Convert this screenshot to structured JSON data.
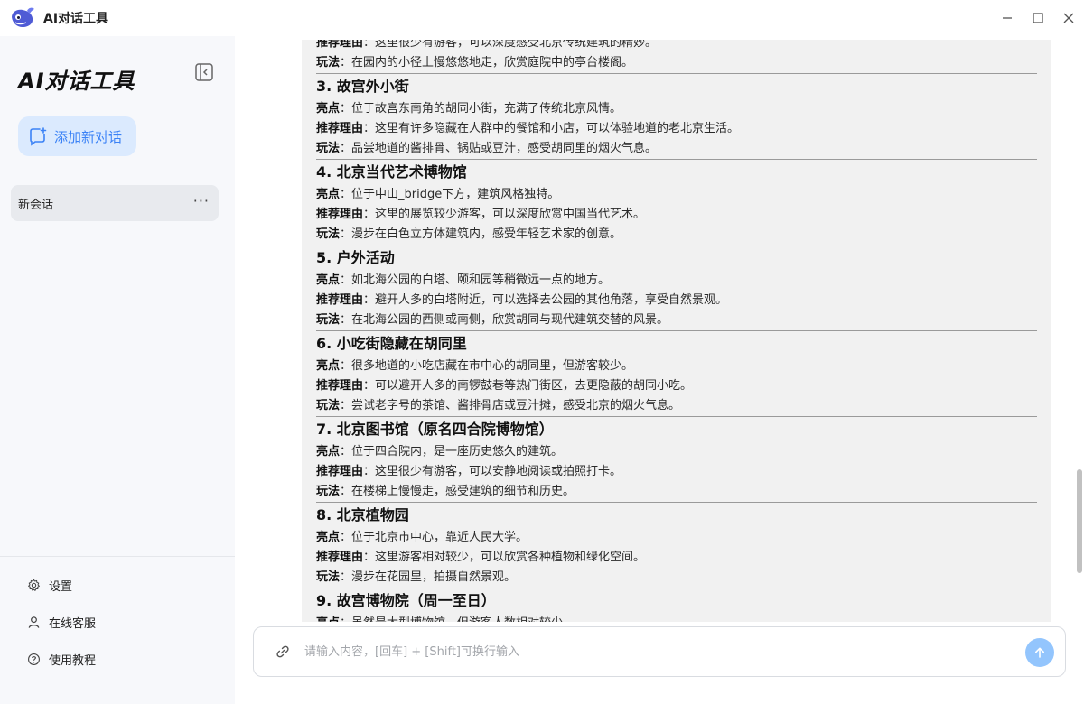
{
  "window": {
    "title": "AI对话工具",
    "logo_icon": "whale-logo-icon",
    "controls": [
      "minimize-icon",
      "maximize-icon",
      "close-icon"
    ]
  },
  "sidebar": {
    "brand": "AI对话工具",
    "new_chat_label": "添加新对话",
    "conversations": [
      {
        "title": "新会话",
        "more": "···"
      }
    ],
    "bottom_links": [
      {
        "label": "设置",
        "icon": "gear-icon"
      },
      {
        "label": "在线客服",
        "icon": "user-icon"
      },
      {
        "label": "使用教程",
        "icon": "help-icon"
      }
    ]
  },
  "message": {
    "top_lines": [
      {
        "key": "推荐理由",
        "text": "：这里很少有游客，可以深度感受北京传统建筑的精妙。"
      },
      {
        "key": "玩法",
        "text": "：在园内的小径上慢悠悠地走，欣赏庭院中的亭台楼阁。"
      }
    ],
    "sections": [
      {
        "title": "3. 故宫外小街",
        "lines": [
          {
            "key": "亮点",
            "text": "：位于故宫东南角的胡同小街，充满了传统北京风情。"
          },
          {
            "key": "推荐理由",
            "text": "：这里有许多隐藏在人群中的餐馆和小店，可以体验地道的老北京生活。"
          },
          {
            "key": "玩法",
            "text": "：品尝地道的酱排骨、锅贴或豆汁，感受胡同里的烟火气息。"
          }
        ]
      },
      {
        "title": "4. 北京当代艺术博物馆",
        "lines": [
          {
            "key": "亮点",
            "text": "：位于中山_bridge下方，建筑风格独特。"
          },
          {
            "key": "推荐理由",
            "text": "：这里的展览较少游客，可以深度欣赏中国当代艺术。"
          },
          {
            "key": "玩法",
            "text": "：漫步在白色立方体建筑内，感受年轻艺术家的创意。"
          }
        ]
      },
      {
        "title": "5. 户外活动",
        "lines": [
          {
            "key": "亮点",
            "text": "：如北海公园的白塔、颐和园等稍微远一点的地方。"
          },
          {
            "key": "推荐理由",
            "text": "：避开人多的白塔附近，可以选择去公园的其他角落，享受自然景观。"
          },
          {
            "key": "玩法",
            "text": "：在北海公园的西侧或南侧，欣赏胡同与现代建筑交替的风景。"
          }
        ]
      },
      {
        "title": "6. 小吃街隐藏在胡同里",
        "lines": [
          {
            "key": "亮点",
            "text": "：很多地道的小吃店藏在市中心的胡同里，但游客较少。"
          },
          {
            "key": "推荐理由",
            "text": "：可以避开人多的南锣鼓巷等热门街区，去更隐蔽的胡同小吃。"
          },
          {
            "key": "玩法",
            "text": "：尝试老字号的茶馆、酱排骨店或豆汁摊，感受北京的烟火气息。"
          }
        ]
      },
      {
        "title": "7. 北京图书馆（原名四合院博物馆）",
        "lines": [
          {
            "key": "亮点",
            "text": "：位于四合院内，是一座历史悠久的建筑。"
          },
          {
            "key": "推荐理由",
            "text": "：这里很少有游客，可以安静地阅读或拍照打卡。"
          },
          {
            "key": "玩法",
            "text": "：在楼梯上慢慢走，感受建筑的细节和历史。"
          }
        ]
      },
      {
        "title": "8. 北京植物园",
        "lines": [
          {
            "key": "亮点",
            "text": "：位于北京市中心，靠近人民大学。"
          },
          {
            "key": "推荐理由",
            "text": "：这里游客相对较少，可以欣赏各种植物和绿化空间。"
          },
          {
            "key": "玩法",
            "text": "：漫步在花园里，拍摄自然景观。"
          }
        ]
      },
      {
        "title": "9. 故宫博物院（周一至日）",
        "lines": [
          {
            "key": "亮点",
            "text": "：虽然是大型博物馆，但游客人数相对较少。"
          }
        ]
      }
    ]
  },
  "input": {
    "placeholder": "请输入内容，[回车] + [Shift]可换行输入",
    "attach_icon": "link-icon",
    "send_icon": "arrow-up-icon"
  },
  "colors": {
    "accent": "#3b82f6",
    "accent_light": "#dbeafe",
    "send_button": "#93c5fd",
    "sidebar_bg": "#f7f8fb",
    "message_bg": "#f1f1f1"
  }
}
